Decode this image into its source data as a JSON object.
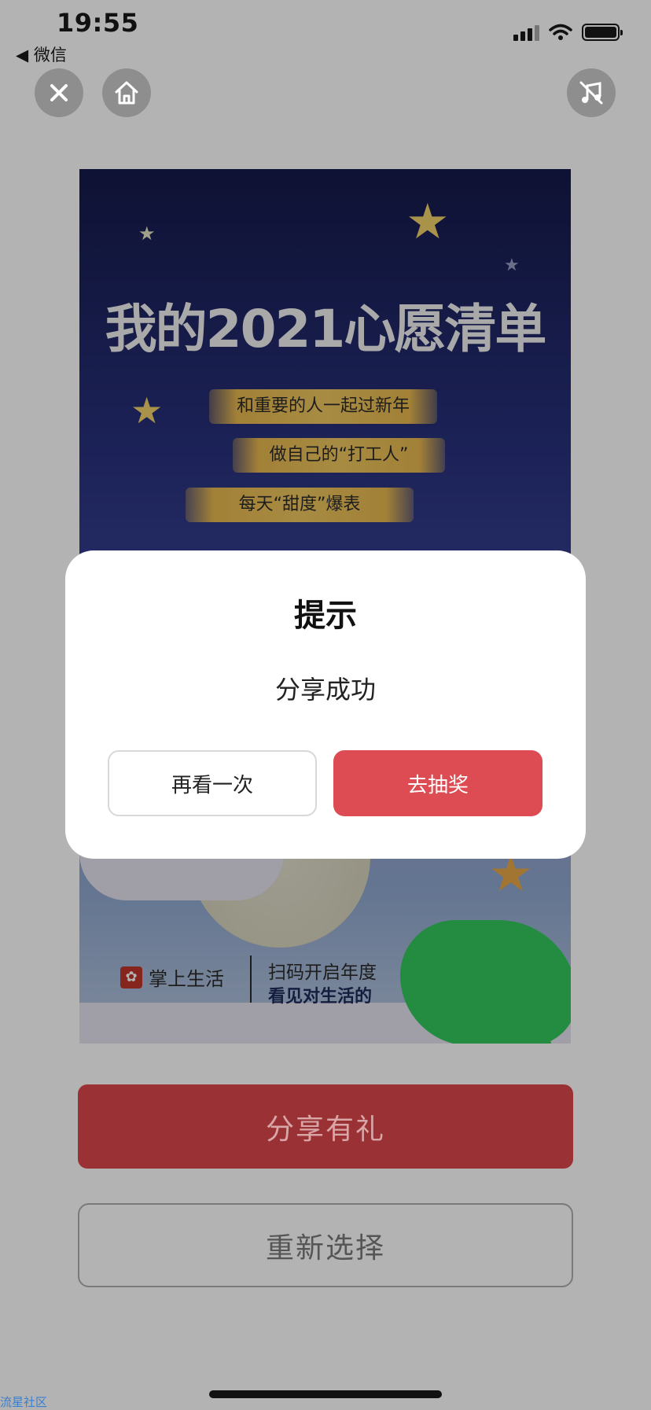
{
  "status_bar": {
    "time": "19:55",
    "back_label": "◀ 微信"
  },
  "poster": {
    "title": "我的2021心愿清单",
    "wishes": [
      "和重要的人一起过新年",
      "做自己的“打工人”",
      "每天“甜度”爆表"
    ],
    "brand": "掌上生活",
    "qr_line1": "扫码开启年度",
    "qr_line2": "看见对生活的"
  },
  "modal": {
    "title": "提示",
    "message": "分享成功",
    "again_label": "再看一次",
    "lottery_label": "去抽奖"
  },
  "buttons": {
    "share_label": "分享有礼",
    "reselect_label": "重新选择"
  },
  "watermark": "流星社区",
  "colors": {
    "share_button": "#9a3235",
    "lottery_button": "#dc4c52",
    "overlay_bg": "#b3b3b3"
  }
}
